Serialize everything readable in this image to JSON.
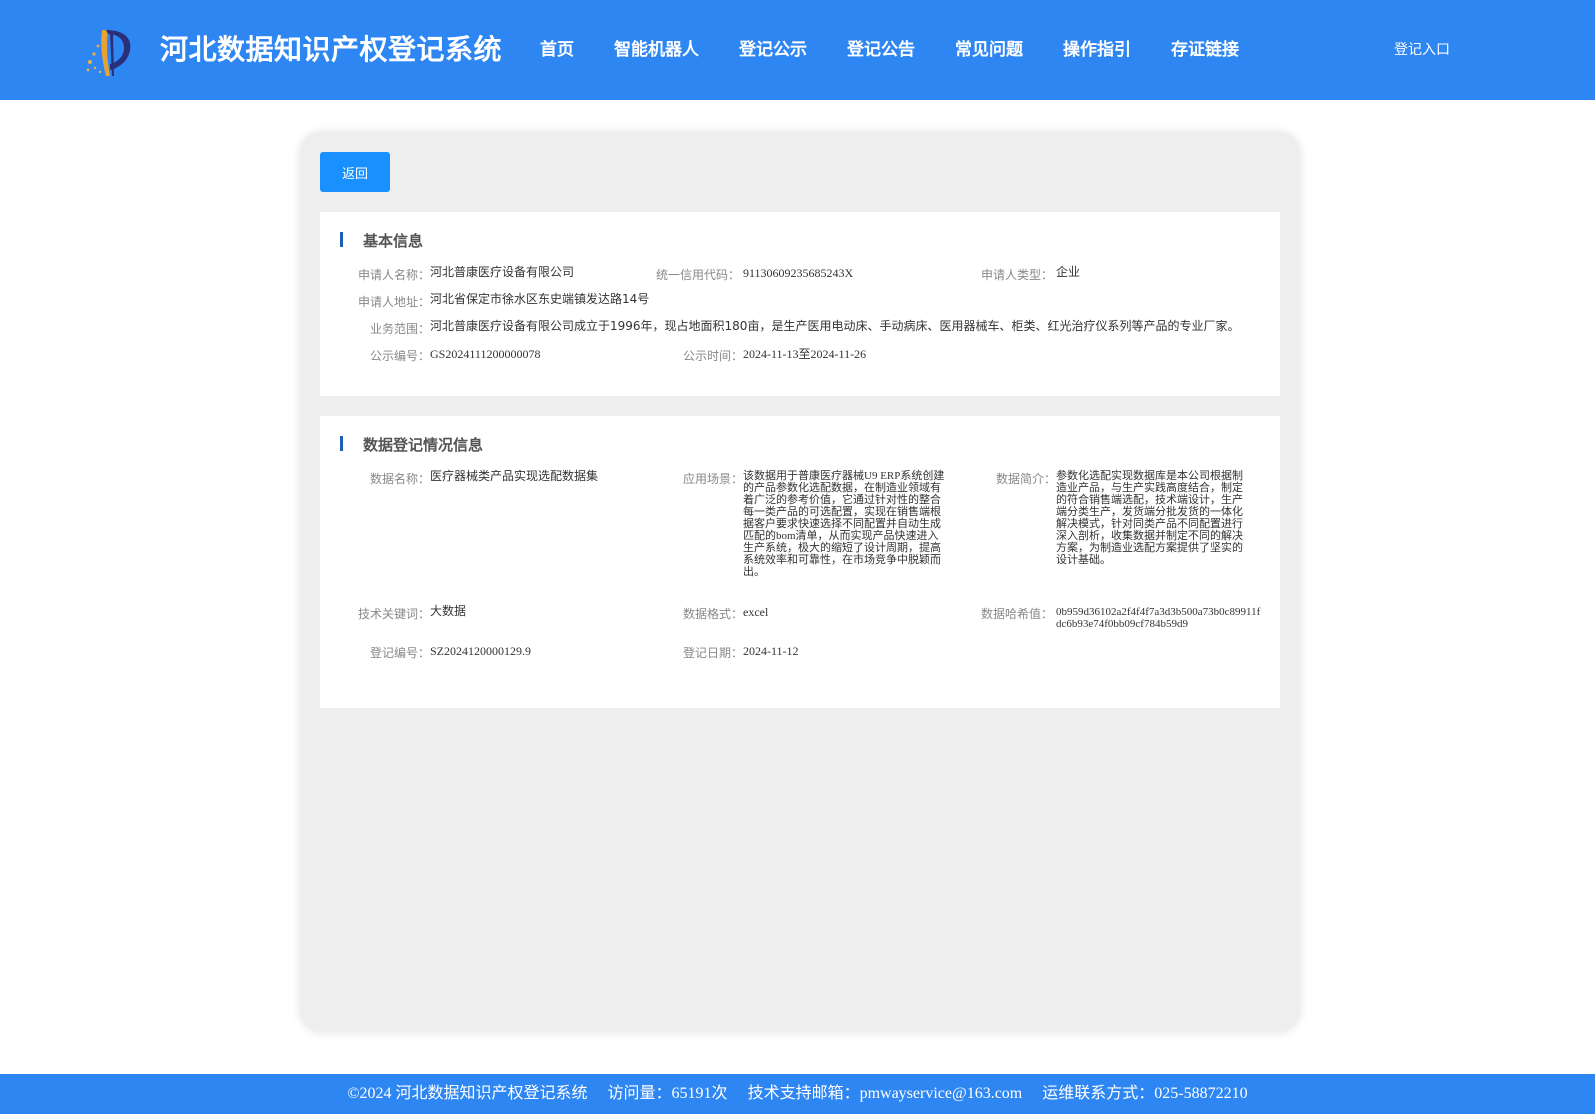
{
  "header": {
    "logo_icon": "logo-icon",
    "site_title": "河北数据知识产权登记系统",
    "nav": [
      "首页",
      "智能机器人",
      "登记公示",
      "登记公告",
      "常见问题",
      "操作指引",
      "存证链接"
    ],
    "login": "登记入口"
  },
  "back_button": "返回",
  "basic_info": {
    "title": "基本信息",
    "applicant_name_label": "申请人名称：",
    "applicant_name": "河北普康医疗设备有限公司",
    "credit_code_label": "统一信用代码：",
    "credit_code": "91130609235685243X",
    "applicant_type_label": "申请人类型：",
    "applicant_type": "企业",
    "address_label": "申请人地址：",
    "address": "河北省保定市徐水区东史端镇发达路14号",
    "business_scope_label": "业务范围：",
    "business_scope": "河北普康医疗设备有限公司成立于1996年，现占地面积180亩，是生产医用电动床、手动病床、医用器械车、柜类、红光治疗仪系列等产品的专业厂家。",
    "notice_no_label": "公示编号：",
    "notice_no": "GS2024111200000078",
    "notice_time_label": "公示时间：",
    "notice_time": "2024-11-13至2024-11-26"
  },
  "data_info": {
    "title": "数据登记情况信息",
    "data_name_label": "数据名称：",
    "data_name": "医疗器械类产品实现选配数据集",
    "scenario_label": "应用场景：",
    "scenario": "该数据用于普康医疗器械U9 ERP系统创建的产品参数化选配数据，在制造业领域有着广泛的参考价值，它通过针对性的整合每一类产品的可选配置，实现在销售端根据客户要求快速选择不同配置并自动生成匹配的bom清单，从而实现产品快速进入生产系统，极大的缩短了设计周期，提高系统效率和可靠性，在市场竞争中脱颖而出。",
    "intro_label": "数据简介：",
    "intro": "参数化选配实现数据库是本公司根据制造业产品，与生产实践高度结合，制定的符合销售端选配，技术端设计，生产端分类生产，发货端分批发货的一体化解决模式，针对同类产品不同配置进行深入剖析，收集数据并制定不同的解决方案，为制造业选配方案提供了坚实的设计基础。",
    "keywords_label": "技术关键词：",
    "keywords": "大数据",
    "format_label": "数据格式：",
    "format": "excel",
    "hash_label": "数据哈希值：",
    "hash": "0b959d36102a2f4f4f7a3d3b500a73b0c89911fdc6b93e74f0bb09cf784b59d9",
    "reg_no_label": "登记编号：",
    "reg_no": "SZ2024120000129.9",
    "reg_date_label": "登记日期：",
    "reg_date": "2024-11-12"
  },
  "footer": {
    "copyright": "©2024 河北数据知识产权登记系统",
    "visits": "访问量：65191次",
    "email": "技术支持邮箱：pmwayservice@163.com",
    "phone": "运维联系方式：025-58872210"
  },
  "colors": {
    "header_bg": "#2e86f3",
    "button_bg": "#1890ff",
    "title_bar": "#1c5fb8",
    "panel_bg": "#eeeeee"
  }
}
